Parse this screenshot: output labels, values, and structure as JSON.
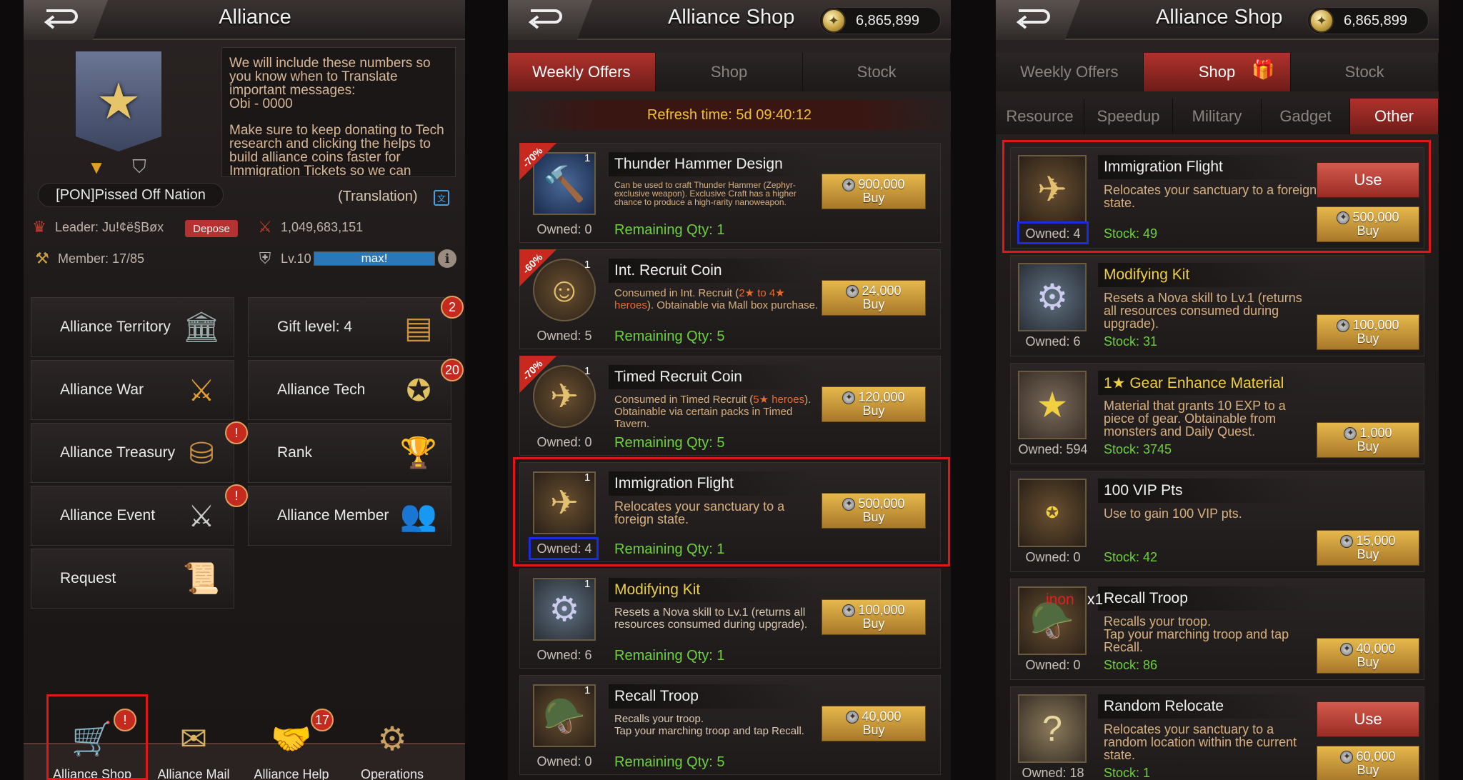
{
  "panel1": {
    "title": "Alliance",
    "message_lines": [
      "We will include these numbers so you know when to Translate important messages:",
      "Obi - 0000",
      "Make sure to keep donating to Tech research and clicking the helps to build alliance coins faster for Immigration Tickets so we can"
    ],
    "alliance_name": "[PON]Pissed Off Nation",
    "translation_label": "(Translation)",
    "leader": "Leader: Ju!¢ë§Bøx",
    "depose": "Depose",
    "power": "1,049,683,151",
    "member": "Member: 17/85",
    "level": "Lv.10",
    "level_bar": "max!",
    "menu": [
      {
        "label": "Alliance Territory",
        "badge": ""
      },
      {
        "label": "Gift level: 4",
        "badge": "2"
      },
      {
        "label": "Alliance War",
        "badge": ""
      },
      {
        "label": "Alliance Tech",
        "badge": "20"
      },
      {
        "label": "Alliance Treasury",
        "badge": "!"
      },
      {
        "label": "Rank",
        "badge": ""
      },
      {
        "label": "Alliance Event",
        "badge": "!"
      },
      {
        "label": "Alliance Member",
        "badge": ""
      },
      {
        "label": "Request",
        "badge": ""
      }
    ],
    "nav": [
      {
        "label": "Alliance Shop",
        "badge": "!"
      },
      {
        "label": "Alliance Mail",
        "badge": ""
      },
      {
        "label": "Alliance Help",
        "badge": "17"
      },
      {
        "label": "Operations",
        "badge": ""
      }
    ]
  },
  "panel2": {
    "title": "Alliance Shop",
    "coins": "6,865,899",
    "tabs": [
      "Weekly Offers",
      "Shop",
      "Stock"
    ],
    "active_tab": "Weekly Offers",
    "refresh": "Refresh time: 5d 09:40:12",
    "items": [
      {
        "discount": "-70%",
        "qty": "1",
        "name": "Thunder Hammer Design",
        "desc": "Can be used to craft Thunder Hammer (Zephyr-exclusive weapon). Exclusive Craft has a higher chance to produce a high-rarity nanoweapon.",
        "owned": "Owned: 0",
        "remaining": "Remaining Qty: 1",
        "price": "900,000",
        "buy": "Buy",
        "icon": "blueprint-icon"
      },
      {
        "discount": "-60%",
        "qty": "1",
        "name": "Int. Recruit Coin",
        "desc_a": "Consumed in Int. Recruit (",
        "desc_hl": "2★ to 4★ heroes",
        "desc_b": "). Obtainable via Mall box purchase.",
        "owned": "Owned: 5",
        "remaining": "Remaining Qty: 5",
        "price": "24,000",
        "buy": "Buy",
        "icon": "coin-icon"
      },
      {
        "discount": "-70%",
        "qty": "1",
        "name": "Timed Recruit Coin",
        "desc_a": "Consumed in Timed Recruit (",
        "desc_hl": "5★ heroes",
        "desc_b": "). Obtainable via certain packs in Timed Tavern.",
        "owned": "Owned: 0",
        "remaining": "Remaining Qty: 5",
        "price": "120,000",
        "buy": "Buy",
        "icon": "coin-icon"
      },
      {
        "discount": "",
        "qty": "1",
        "name": "Immigration Flight",
        "desc": "Relocates your sanctuary to a foreign state.",
        "owned": "Owned: 4",
        "remaining": "Remaining Qty: 1",
        "price": "500,000",
        "buy": "Buy",
        "icon": "plane-icon"
      },
      {
        "discount": "",
        "qty": "1",
        "name": "Modifying Kit",
        "desc": "Resets a Nova skill to Lv.1 (returns all resources consumed during upgrade).",
        "owned": "Owned: 6",
        "remaining": "Remaining Qty: 1",
        "price": "100,000",
        "buy": "Buy",
        "icon": "kit-icon"
      },
      {
        "discount": "",
        "qty": "1",
        "name": "Recall Troop",
        "desc": "Recalls your troop.\nTap your marching troop and tap Recall.",
        "owned": "Owned: 0",
        "remaining": "Remaining Qty: 5",
        "price": "40,000",
        "buy": "Buy",
        "icon": "soldier-icon"
      }
    ]
  },
  "panel3": {
    "title": "Alliance Shop",
    "coins": "6,865,899",
    "tabs": [
      "Weekly Offers",
      "Shop",
      "Stock"
    ],
    "active_tab": "Shop",
    "subtabs": [
      "Resource",
      "Speedup",
      "Military",
      "Gadget",
      "Other"
    ],
    "active_subtab": "Other",
    "items": [
      {
        "name": "Immigration Flight",
        "desc": "Relocates your sanctuary to a foreign state.",
        "owned": "Owned: 4",
        "stock": "Stock: 49",
        "price": "500,000",
        "buy": "Buy",
        "use": "Use",
        "icon": "plane-icon"
      },
      {
        "name": "Modifying Kit",
        "desc": "Resets a Nova skill to Lv.1 (returns all resources consumed during upgrade).",
        "owned": "Owned: 6",
        "stock": "Stock: 31",
        "price": "100,000",
        "buy": "Buy",
        "use": "",
        "icon": "kit-icon"
      },
      {
        "name": "1★ Gear Enhance Material",
        "desc": "Material that grants 10 EXP to a piece of gear. Obtainable from monsters and Daily Quest.",
        "owned": "Owned: 594",
        "stock": "Stock: 3745",
        "price": "1,000",
        "buy": "Buy",
        "use": "",
        "icon": "material-icon"
      },
      {
        "name": "100 VIP Pts",
        "desc": "Use to gain 100 VIP pts.",
        "owned": "Owned: 0",
        "stock": "Stock: 42",
        "price": "15,000",
        "buy": "Buy",
        "use": "",
        "icon": "vip-icon"
      },
      {
        "name": "Recall Troop",
        "desc": "Recalls your troop.\nTap your marching troop and tap Recall.",
        "owned": "Owned: 0",
        "stock": "Stock: 86",
        "price": "40,000",
        "buy": "Buy",
        "use": "",
        "icon": "soldier-icon"
      },
      {
        "name": "Random Relocate",
        "desc": "Relocates your sanctuary to a random location within the current state.",
        "owned": "Owned: 18",
        "stock": "Stock: 1",
        "price": "60,000",
        "buy": "Buy",
        "use": "Use",
        "icon": "question-icon"
      }
    ],
    "overlay_text": "inon",
    "overlay_qty": "x1"
  }
}
